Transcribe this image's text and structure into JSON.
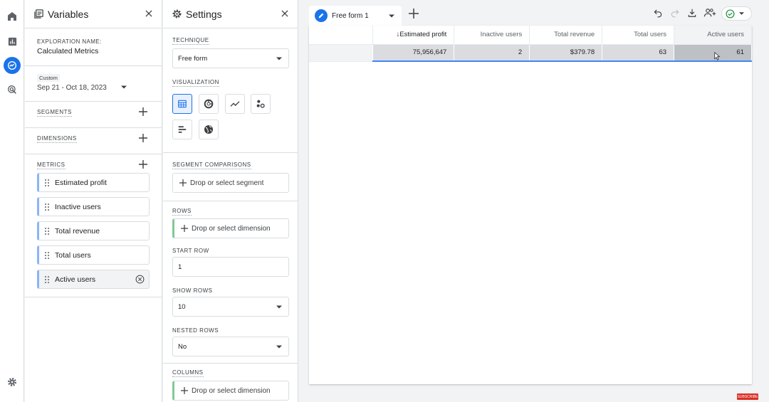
{
  "rail": {
    "icons": [
      "home-icon",
      "reports-icon",
      "explore-icon",
      "advertising-icon",
      "admin-gear-icon"
    ]
  },
  "variables": {
    "title": "Variables",
    "exploration_name_label": "EXPLORATION NAME:",
    "exploration_name": "Calculated Metrics",
    "date_badge": "Custom",
    "date_range": "Sep 21 - Oct 18, 2023",
    "segments_label": "SEGMENTS",
    "dimensions_label": "DIMENSIONS",
    "metrics_label": "METRICS",
    "metrics": [
      "Estimated profit",
      "Inactive users",
      "Total revenue",
      "Total users",
      "Active users"
    ]
  },
  "settings": {
    "title": "Settings",
    "technique_label": "TECHNIQUE",
    "technique_value": "Free form",
    "visualization_label": "VISUALIZATION",
    "segment_comparisons_label": "SEGMENT COMPARISONS",
    "segment_drop": "Drop or select segment",
    "rows_label": "ROWS",
    "rows_drop": "Drop or select dimension",
    "start_row_label": "START ROW",
    "start_row_value": "1",
    "show_rows_label": "SHOW ROWS",
    "show_rows_value": "10",
    "nested_rows_label": "NESTED ROWS",
    "nested_rows_value": "No",
    "columns_label": "COLUMNS",
    "columns_drop": "Drop or select dimension"
  },
  "canvas": {
    "tab_label": "Free form 1",
    "table": {
      "headers": [
        "Estimated profit",
        "Inactive users",
        "Total revenue",
        "Total users",
        "Active users"
      ],
      "sort_arrow": "↓",
      "row": [
        "75,956,647",
        "2",
        "$379.78",
        "63",
        "61"
      ]
    }
  },
  "watermark": "SUBSCRIBE",
  "colors": {
    "accent": "#1a73e8",
    "metric_chip": "#8ab4f8",
    "dimension_bar": "#81c995",
    "success": "#1e8e3e"
  }
}
